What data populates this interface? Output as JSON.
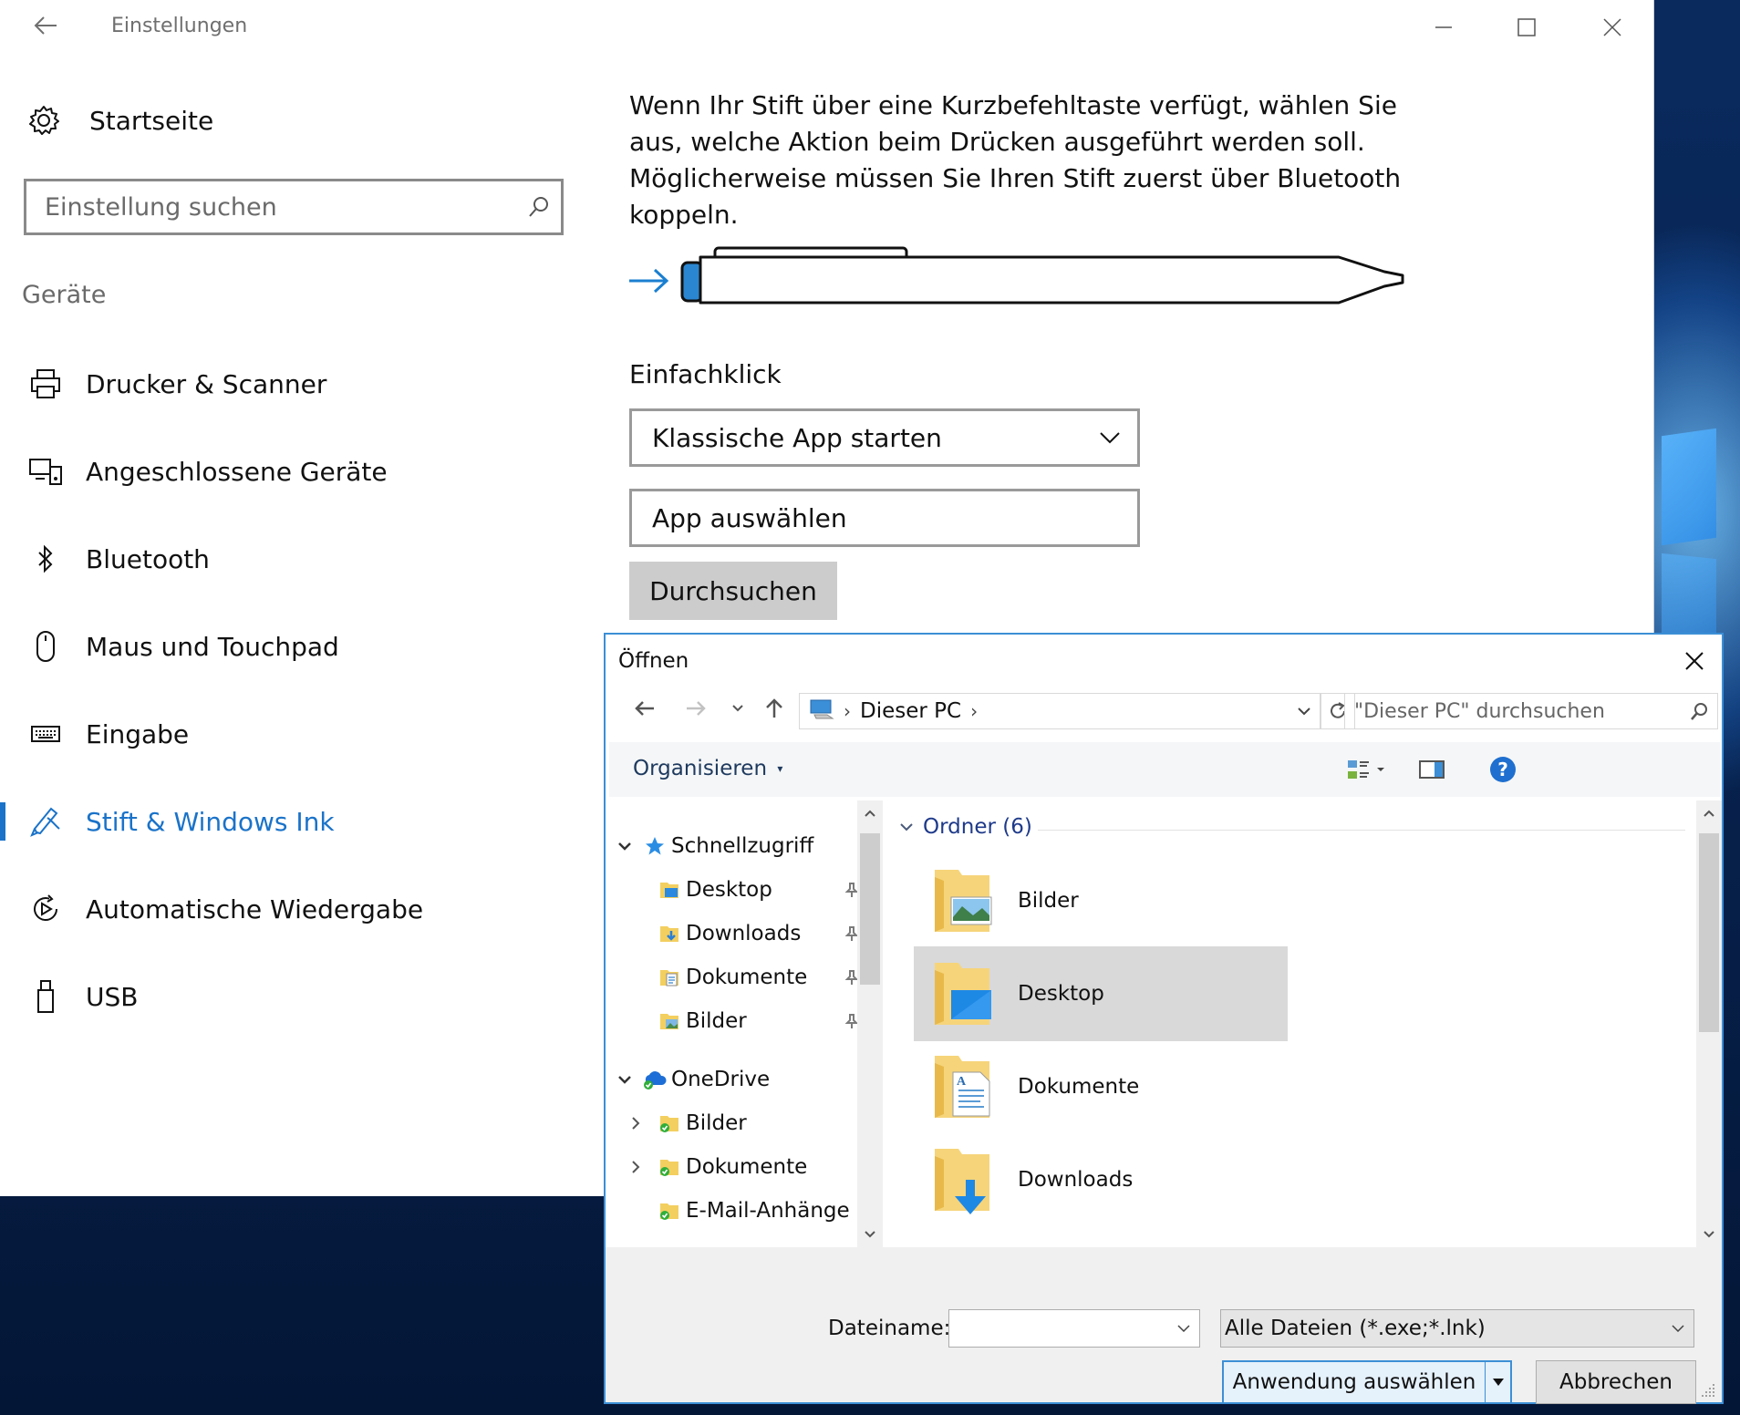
{
  "settings": {
    "title": "Einstellungen",
    "home": "Startseite",
    "search_placeholder": "Einstellung suchen",
    "section": "Geräte",
    "nav": [
      {
        "label": "Drucker & Scanner",
        "icon": "printer-icon"
      },
      {
        "label": "Angeschlossene Geräte",
        "icon": "connected-devices-icon"
      },
      {
        "label": "Bluetooth",
        "icon": "bluetooth-icon"
      },
      {
        "label": "Maus und Touchpad",
        "icon": "mouse-icon"
      },
      {
        "label": "Eingabe",
        "icon": "keyboard-icon"
      },
      {
        "label": "Stift & Windows Ink",
        "icon": "pen-icon",
        "active": true
      },
      {
        "label": "Automatische Wiedergabe",
        "icon": "autoplay-icon"
      },
      {
        "label": "USB",
        "icon": "usb-icon"
      }
    ],
    "content": {
      "description": "Wenn Ihr Stift über eine Kurzbefehltaste verfügt, wählen Sie aus, welche Aktion beim Drücken ausgeführt werden soll. Möglicherweise müssen Sie Ihren Stift zuerst über Bluetooth koppeln.",
      "click_label": "Einfachklick",
      "click_value": "Klassische App starten",
      "app_field": "App auswählen",
      "browse_button": "Durchsuchen"
    }
  },
  "dialog": {
    "title": "Öffnen",
    "address": "Dieser PC",
    "search_placeholder": "\"Dieser PC\" durchsuchen",
    "organize": "Organisieren",
    "tree": {
      "quick_access": "Schnellzugriff",
      "quick_items": [
        "Desktop",
        "Downloads",
        "Dokumente",
        "Bilder"
      ],
      "onedrive": "OneDrive",
      "onedrive_items": [
        "Bilder",
        "Dokumente",
        "E-Mail-Anhänge"
      ]
    },
    "group_header": "Ordner (6)",
    "folders": [
      "Bilder",
      "Desktop",
      "Dokumente",
      "Downloads"
    ],
    "selected_folder": "Desktop",
    "filename_label": "Dateiname:",
    "filename_value": "",
    "filetype": "Alle Dateien (*.exe;*.lnk)",
    "open_button": "Anwendung auswählen",
    "cancel_button": "Abbrechen"
  },
  "colors": {
    "accent": "#1a73c9",
    "dialog_border": "#3c8fd6",
    "selection": "#d9d9d9"
  }
}
